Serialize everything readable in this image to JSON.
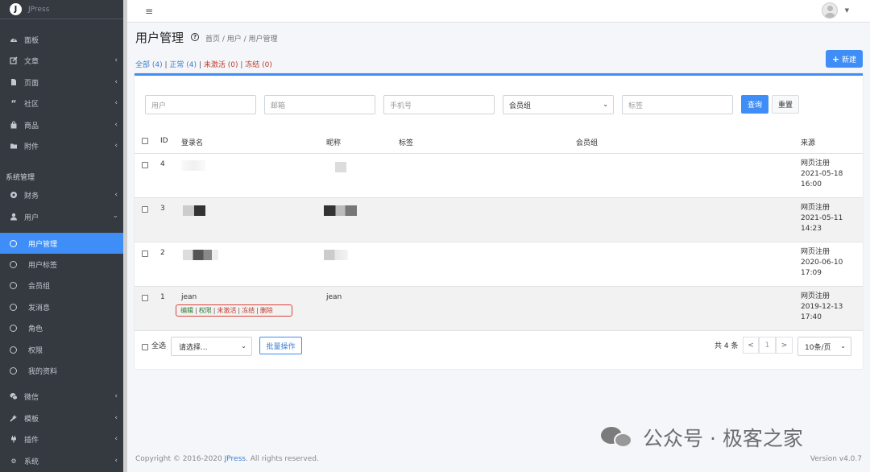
{
  "brand": {
    "logo": "J",
    "name": "JPress"
  },
  "sidebar": {
    "items_top": [
      {
        "label": "面板",
        "icon": "dashboard-icon",
        "chevron": false
      },
      {
        "label": "文章",
        "icon": "edit-icon",
        "chevron": true
      },
      {
        "label": "页面",
        "icon": "file-icon",
        "chevron": true
      },
      {
        "label": "社区",
        "icon": "quote-icon",
        "chevron": true
      },
      {
        "label": "商品",
        "icon": "shopping-bag-icon",
        "chevron": true
      },
      {
        "label": "附件",
        "icon": "folder-icon",
        "chevron": true
      }
    ],
    "section_header": "系统管理",
    "items_system": [
      {
        "label": "财务",
        "icon": "finance-icon",
        "chevron": true
      },
      {
        "label": "用户",
        "icon": "user-icon",
        "chevron": "down"
      }
    ],
    "user_sub": [
      "用户管理",
      "用户标签",
      "会员组",
      "发消息",
      "角色",
      "权限",
      "我的资料"
    ],
    "items_bottom": [
      {
        "label": "微信",
        "icon": "wechat-icon",
        "chevron": true
      },
      {
        "label": "模板",
        "icon": "template-icon",
        "chevron": true
      },
      {
        "label": "插件",
        "icon": "plugin-icon",
        "chevron": true
      },
      {
        "label": "系统",
        "icon": "gear-icon",
        "chevron": true
      }
    ]
  },
  "header": {
    "menu_icon": "hamburger-icon",
    "avatar_icon": "avatar-icon"
  },
  "page": {
    "title": "用户管理",
    "breadcrumb": "首页 / 用户 / 用户管理",
    "filters": {
      "all": "全部 (4)",
      "normal": "正常 (4)",
      "inactive": "未激活 (0)",
      "frozen": "冻结 (0)",
      "sep": "|"
    },
    "new_button": "新建"
  },
  "search": {
    "user_placeholder": "用户",
    "email_placeholder": "邮箱",
    "phone_placeholder": "手机号",
    "group_select": "会员组",
    "tag_placeholder": "标签",
    "query_button": "查询",
    "reset_button": "重置"
  },
  "table": {
    "headers": {
      "id": "ID",
      "login": "登录名",
      "nickname": "昵称",
      "tags": "标签",
      "group": "会员组",
      "source": "来源"
    },
    "rows": [
      {
        "id": "4",
        "login": "",
        "nickname": "",
        "source": "网页注册",
        "date": "2021-05-18",
        "time": "16:00"
      },
      {
        "id": "3",
        "login": "",
        "nickname": "",
        "source": "网页注册",
        "date": "2021-05-11",
        "time": "14:23"
      },
      {
        "id": "2",
        "login": "",
        "nickname": "",
        "source": "网页注册",
        "date": "2020-06-10",
        "time": "17:09"
      },
      {
        "id": "1",
        "login": "jean",
        "nickname": "jean",
        "source": "网页注册",
        "date": "2019-12-13",
        "time": "17:40"
      }
    ],
    "row_actions": {
      "edit": "编辑",
      "perm": "权限",
      "inactive": "未激活",
      "freeze": "冻结",
      "delete": "删除",
      "sep": "|"
    }
  },
  "footer_bar": {
    "select_all": "全选",
    "bulk_select": "请选择...",
    "bulk_button": "批量操作",
    "total": "共 4 条",
    "prev": "<",
    "page": "1",
    "next": ">",
    "page_size": "10条/页"
  },
  "copyright": {
    "prefix": "Copyright © 2016-2020 ",
    "brand": "JPress",
    "suffix": ". All rights reserved."
  },
  "version": "Version v4.0.7",
  "watermark": "公众号 · 极客之家",
  "colors": {
    "primary": "#3f8ef7",
    "sidebar": "#343a40",
    "danger": "#d9443a",
    "success": "#2e7d32"
  }
}
